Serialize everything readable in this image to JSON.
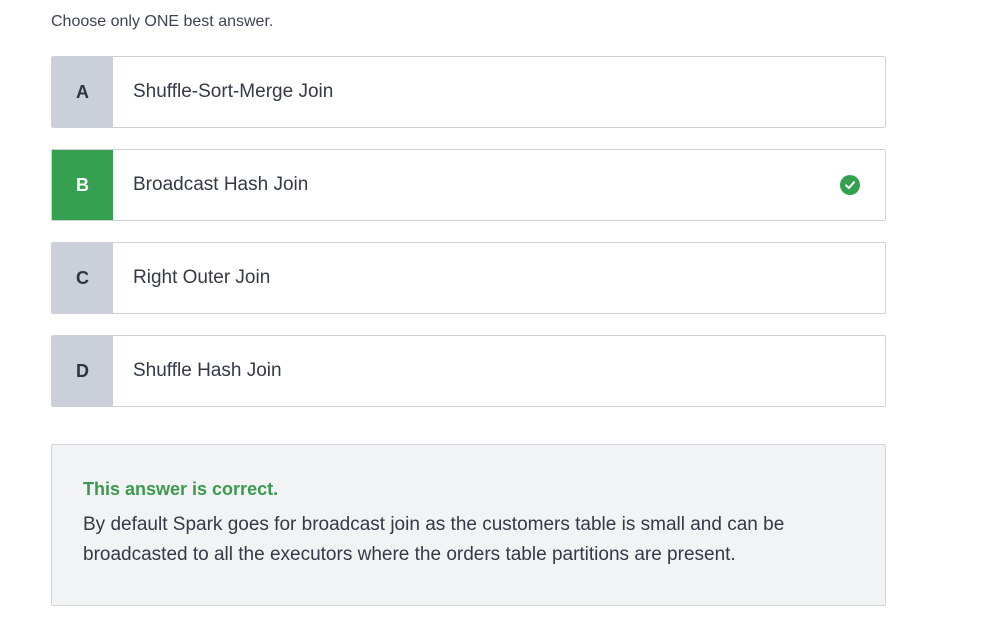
{
  "instruction": "Choose only ONE best answer.",
  "options": [
    {
      "letter": "A",
      "text": "Shuffle-Sort-Merge Join"
    },
    {
      "letter": "B",
      "text": "Broadcast Hash Join",
      "correct": true
    },
    {
      "letter": "C",
      "text": "Right Outer Join"
    },
    {
      "letter": "D",
      "text": "Shuffle Hash Join"
    }
  ],
  "feedback": {
    "title": "This answer is correct.",
    "text": "By default Spark goes for broadcast join as the customers table is small and can be broadcasted to all the executors where the orders table partitions are present."
  },
  "colors": {
    "correct_green": "#34a050",
    "letter_bg": "#cbcfd9",
    "feedback_bg": "#f2f3f5"
  },
  "icons": {
    "correct_indicator": "check-circle-icon"
  }
}
